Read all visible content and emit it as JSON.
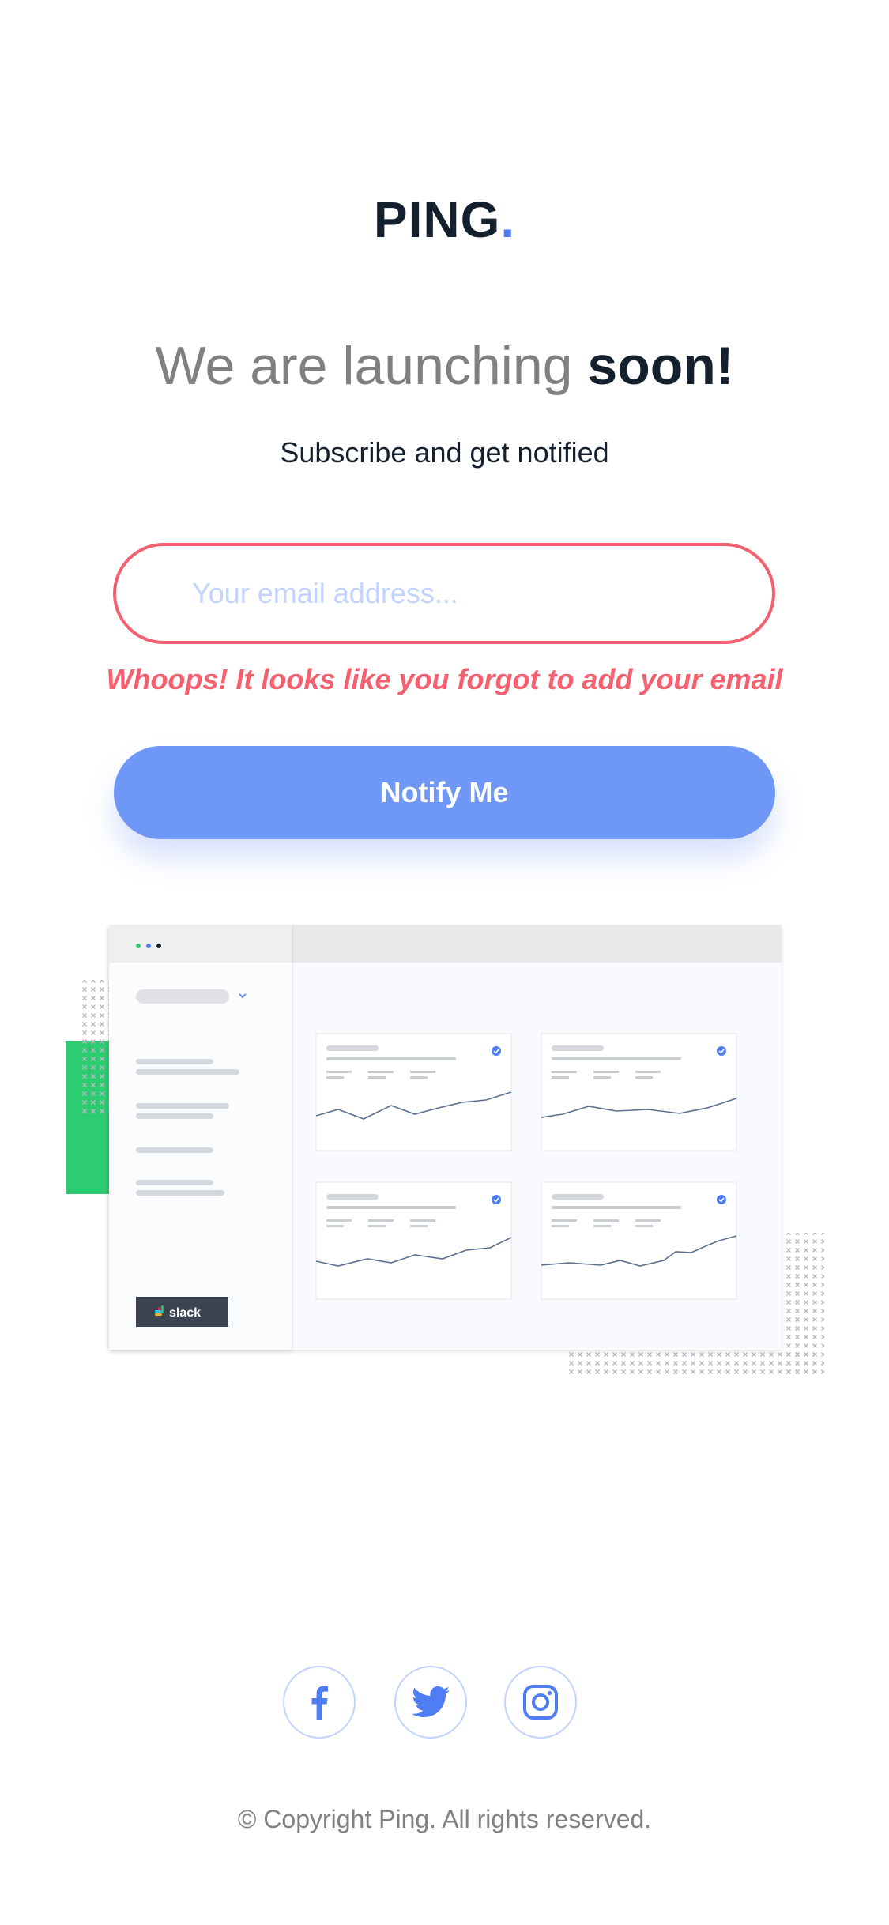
{
  "brand": {
    "name": "PING",
    "dot": "."
  },
  "hero": {
    "headline_light": "We are launching ",
    "headline_bold": "soon!",
    "subtitle": "Subscribe and get notified"
  },
  "form": {
    "email_placeholder": "Your email address...",
    "email_value": "",
    "error": "Whoops! It looks like you forgot to add your email",
    "submit_label": "Notify Me"
  },
  "dashboard": {
    "slack_label": "slack"
  },
  "social": [
    {
      "icon": "facebook-icon"
    },
    {
      "icon": "twitter-icon"
    },
    {
      "icon": "instagram-icon"
    }
  ],
  "footer": {
    "copyright": "© Copyright Ping. All rights reserved."
  },
  "colors": {
    "brand_blue": "#4f7df3",
    "pale_blue": "#c2d3ff",
    "light_red": "#f4606f",
    "very_dark_blue": "#15202e",
    "gray": "#808080",
    "green": "#2ecc71"
  }
}
